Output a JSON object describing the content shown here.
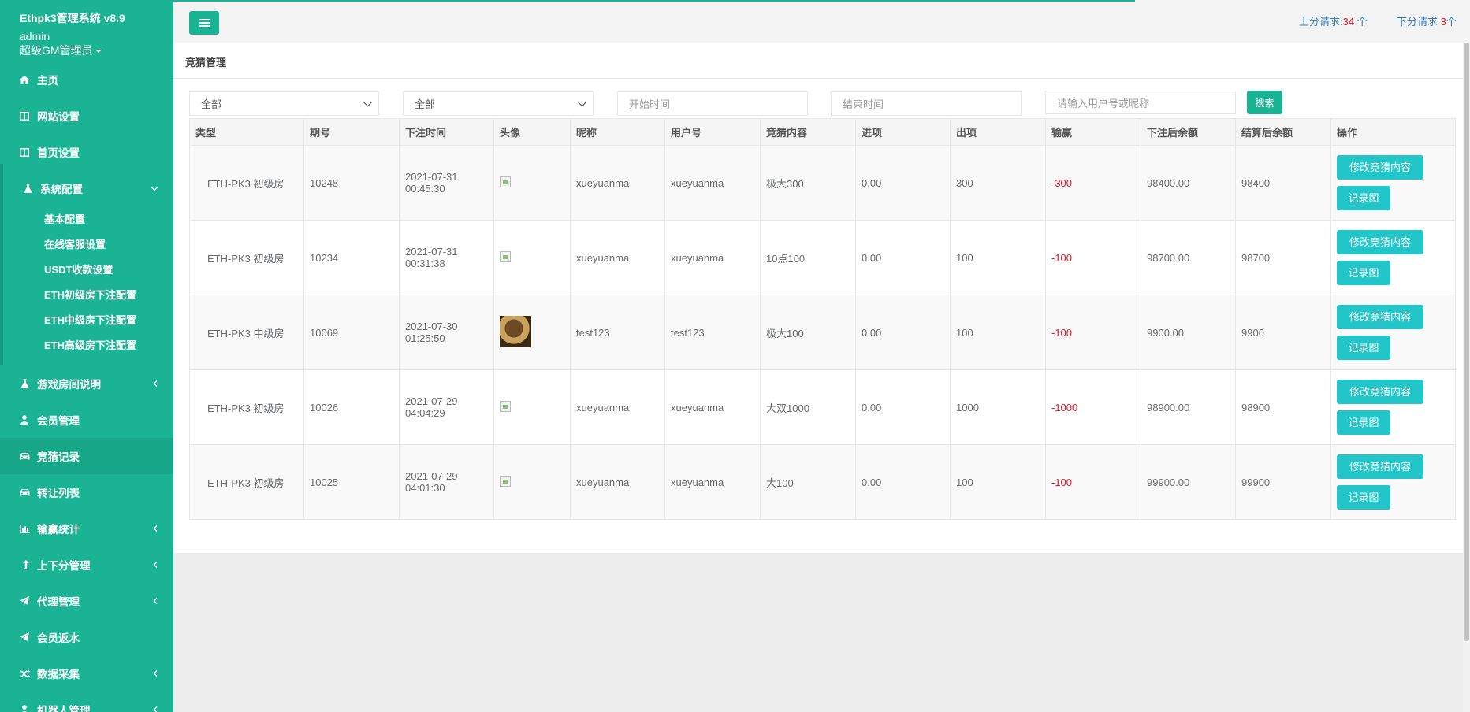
{
  "brand": {
    "title": "Ethpk3管理系统 v8.9",
    "user": "admin",
    "role": "超级GM管理员"
  },
  "sidebar": {
    "items": [
      {
        "label": "主页",
        "icon": "home-icon"
      },
      {
        "label": "网站设置",
        "icon": "columns-icon"
      },
      {
        "label": "首页设置",
        "icon": "columns-icon"
      },
      {
        "label": "系统配置",
        "icon": "flask-icon",
        "expanded": true
      },
      {
        "label": "游戏房间说明",
        "icon": "flask-icon"
      },
      {
        "label": "会员管理",
        "icon": "user-icon"
      },
      {
        "label": "竞猜记录",
        "icon": "car-icon",
        "active": true
      },
      {
        "label": "转让列表",
        "icon": "car-icon"
      },
      {
        "label": "输赢统计",
        "icon": "bar-chart-icon"
      },
      {
        "label": "上下分管理",
        "icon": "level-up-icon"
      },
      {
        "label": "代理管理",
        "icon": "paper-plane-icon"
      },
      {
        "label": "会员返水",
        "icon": "paper-plane-icon"
      },
      {
        "label": "数据采集",
        "icon": "random-icon"
      },
      {
        "label": "机器人管理",
        "icon": "user-icon"
      }
    ],
    "subitems": [
      "基本配置",
      "在线客服设置",
      "USDT收款设置",
      "ETH初级房下注配置",
      "ETH中级房下注配置",
      "ETH高级房下注配置"
    ]
  },
  "topbar": {
    "up_label": "上分请求:",
    "up_count": "34",
    "up_unit": "个",
    "down_label": "下分请求",
    "down_count": "3",
    "down_unit": "个"
  },
  "page": {
    "title": "竞猜管理"
  },
  "filters": {
    "select1": "全部",
    "select2": "全部",
    "start_placeholder": "开始时间",
    "end_placeholder": "结束时间",
    "search_placeholder": "请输入用户号或昵称",
    "search_button": "搜索"
  },
  "table": {
    "headers": [
      "类型",
      "期号",
      "下注时间",
      "头像",
      "昵称",
      "用户号",
      "竞猜内容",
      "进项",
      "出项",
      "输赢",
      "下注后余额",
      "结算后余额",
      "操作"
    ],
    "rows": [
      {
        "type": "ETH-PK3 初级房",
        "period": "10248",
        "date": "2021-07-31",
        "time": "00:45:30",
        "avatar": "broken",
        "nickname": "xueyuanma",
        "user_id": "xueyuanma",
        "content": "极大300",
        "income": "0.00",
        "expense": "300",
        "win_loss": "-300",
        "balance_after_bet": "98400.00",
        "balance_after_settle": "98400"
      },
      {
        "type": "ETH-PK3 初级房",
        "period": "10234",
        "date": "2021-07-31",
        "time": "00:31:38",
        "avatar": "broken",
        "nickname": "xueyuanma",
        "user_id": "xueyuanma",
        "content": "10点100",
        "income": "0.00",
        "expense": "100",
        "win_loss": "-100",
        "balance_after_bet": "98700.00",
        "balance_after_settle": "98700"
      },
      {
        "type": "ETH-PK3 中级房",
        "period": "10069",
        "date": "2021-07-30",
        "time": "01:25:50",
        "avatar": "image",
        "nickname": "test123",
        "user_id": "test123",
        "content": "极大100",
        "income": "0.00",
        "expense": "100",
        "win_loss": "-100",
        "balance_after_bet": "9900.00",
        "balance_after_settle": "9900"
      },
      {
        "type": "ETH-PK3 初级房",
        "period": "10026",
        "date": "2021-07-29",
        "time": "04:04:29",
        "avatar": "broken",
        "nickname": "xueyuanma",
        "user_id": "xueyuanma",
        "content": "大双1000",
        "income": "0.00",
        "expense": "1000",
        "win_loss": "-1000",
        "balance_after_bet": "98900.00",
        "balance_after_settle": "98900"
      },
      {
        "type": "ETH-PK3 初级房",
        "period": "10025",
        "date": "2021-07-29",
        "time": "04:01:30",
        "avatar": "broken",
        "nickname": "xueyuanma",
        "user_id": "xueyuanma",
        "content": "大100",
        "income": "0.00",
        "expense": "100",
        "win_loss": "-100",
        "balance_after_bet": "99900.00",
        "balance_after_settle": "99900"
      }
    ],
    "actions": {
      "edit": "修改竞猜内容",
      "record": "记录图"
    }
  },
  "colors": {
    "sidebar": "#1ab394",
    "button": "#23c6c8",
    "negative": "#ee1122",
    "link": "#337ab7"
  }
}
